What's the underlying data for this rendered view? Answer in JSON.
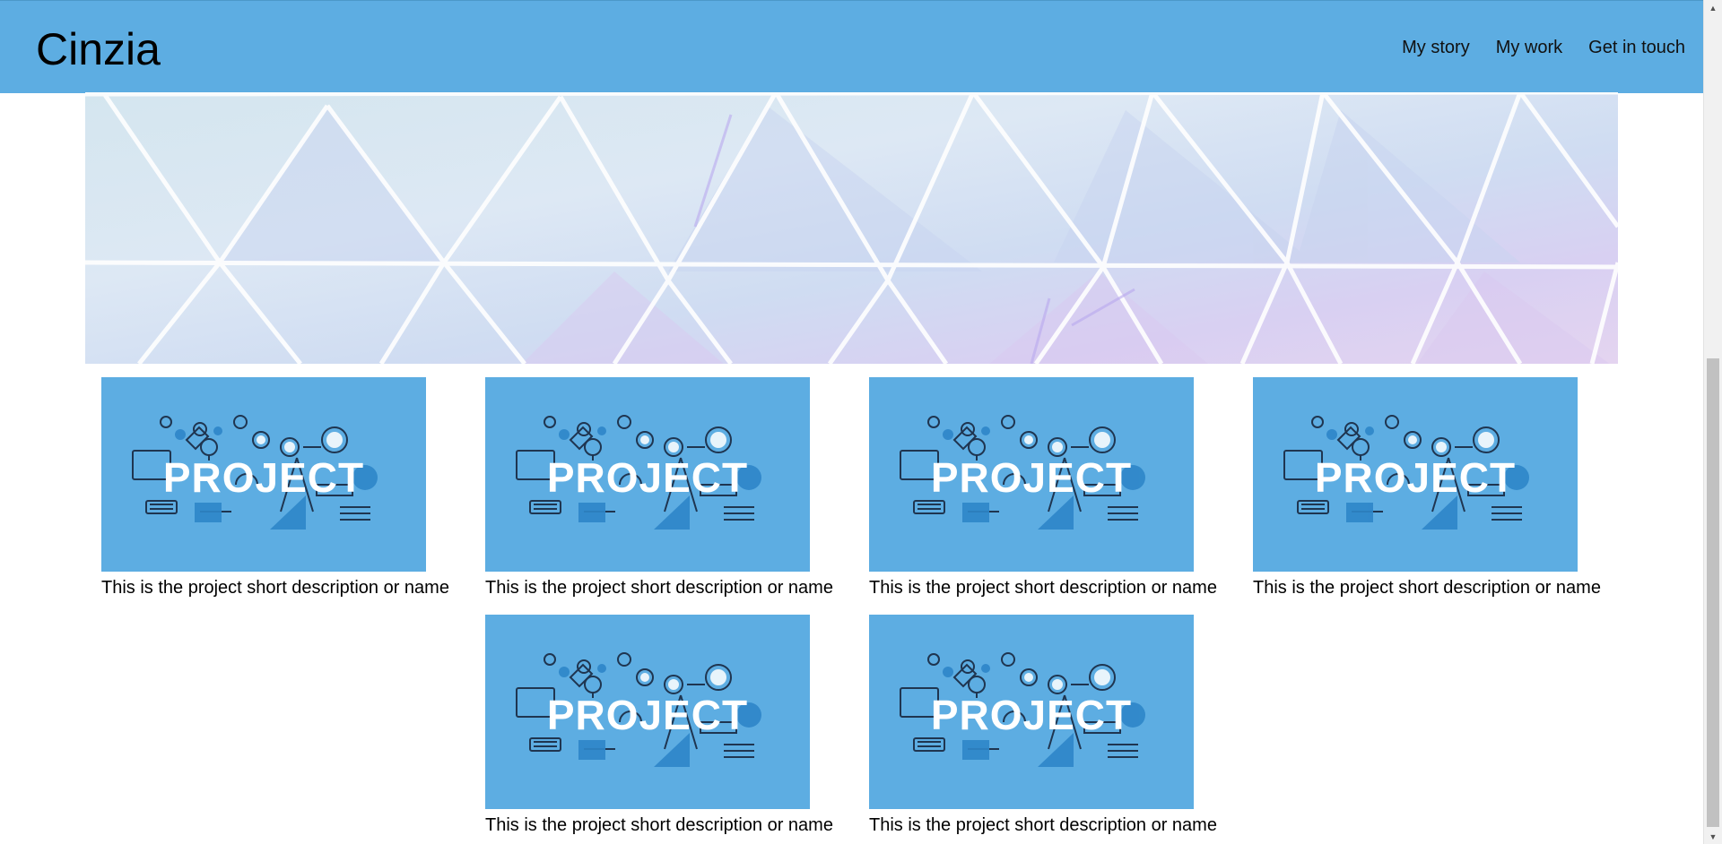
{
  "header": {
    "brand": "Cinzia",
    "nav": [
      "My story",
      "My work",
      "Get in touch"
    ]
  },
  "projects": [
    {
      "caption": "This is the project short description or name",
      "image_word": "PROJECT"
    },
    {
      "caption": "This is the project short description or name",
      "image_word": "PROJECT"
    },
    {
      "caption": "This is the project short description or name",
      "image_word": "PROJECT"
    },
    {
      "caption": "This is the project short description or name",
      "image_word": "PROJECT"
    },
    {
      "caption": "This is the project short description or name",
      "image_word": "PROJECT"
    },
    {
      "caption": "This is the project short description or name",
      "image_word": "PROJECT"
    }
  ],
  "colors": {
    "header_bg": "#5dade2",
    "thumb_bg": "#5dade2",
    "text": "#000000"
  },
  "icons": [
    "scroll-up-arrow-icon",
    "scroll-down-arrow-icon"
  ]
}
